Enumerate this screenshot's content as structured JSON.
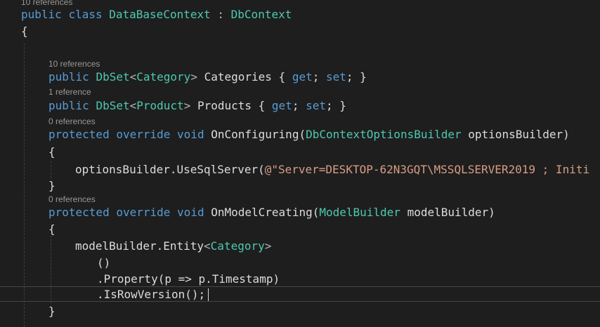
{
  "code": {
    "lens_class": "10 references",
    "class_decl": {
      "kw_public": "public",
      "kw_class": "class",
      "name": "DataBaseContext",
      "colon": " : ",
      "base": "DbContext"
    },
    "open_brace_class": "{",
    "lens_categories": "10 references",
    "categories": {
      "kw_public": "public",
      "dbset": "DbSet",
      "lt": "<",
      "type": "Category",
      "gt": ">",
      "name": " Categories { ",
      "get": "get",
      "semi1": "; ",
      "set": "set",
      "close": "; }"
    },
    "lens_products": "1 reference",
    "products": {
      "kw_public": "public",
      "dbset": "DbSet",
      "lt": "<",
      "type": "Product",
      "gt": ">",
      "name": " Products { ",
      "get": "get",
      "semi1": "; ",
      "set": "set",
      "close": "; }"
    },
    "lens_onconfiguring": "0 references",
    "onconfiguring": {
      "kw_protected": "protected",
      "kw_override": "override",
      "kw_void": "void",
      "name": "OnConfiguring(",
      "param_type": "DbContextOptionsBuilder",
      "param_name": " optionsBuilder)"
    },
    "open_brace_config": "{",
    "use_sql": {
      "call": "optionsBuilder.UseSqlServer(",
      "string": "@\"Server=DESKTOP-62N3GQT\\MSSQLSERVER2019 ; Initi"
    },
    "close_brace_config": "}",
    "lens_onmodelcreating": "0 references",
    "onmodelcreating": {
      "kw_protected": "protected",
      "kw_override": "override",
      "kw_void": "void",
      "name": "OnModelCreating(",
      "param_type": "ModelBuilder",
      "param_name": " modelBuilder)"
    },
    "open_brace_model": "{",
    "entity": {
      "call": "modelBuilder.Entity",
      "lt": "<",
      "type": "Category",
      "gt": ">"
    },
    "parens": "()",
    "property": ".Property(p => p.Timestamp)",
    "isrowversion": ".IsRowVersion();",
    "close_brace_model": "}"
  }
}
